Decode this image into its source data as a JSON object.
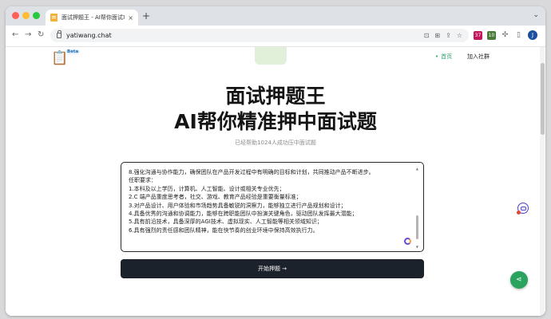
{
  "browser": {
    "tab_title": "面试押题王 - AI帮你面试拿Offer",
    "tab_close": "×",
    "new_tab": "+",
    "url": "yatiwang.chat",
    "profile_initial": "J",
    "ext_badge_a": "37",
    "ext_badge_b": "10"
  },
  "site": {
    "logo_icon": "📋",
    "beta": "Beta",
    "nav": {
      "home": "首页",
      "join": "加入社群"
    }
  },
  "hero": {
    "line1": "面试押题王",
    "line2": "AI帮你精准押中面试题",
    "subtitle": "已经帮助1024人成功压中面试题"
  },
  "job_description": {
    "lines": [
      "8.强化沟通与协作能力，确保团队在产品开发过程中有明确的目标和计划，共同推动产品不断进步。",
      "任职要求：",
      "1.本科及以上学历，计算机、人工智能、设计或相关专业优先；",
      "2.C 端产品重度思考者，社交、游戏、教育产品经验是重要衡量标准；",
      "3.对产品设计、用户体验和市场趋势具备敏锐的洞察力，能够独立进行产品规划和设计；",
      "4.具备优秀的沟通和协调能力，能够在跨职能团队中扮演关键角色，驱动团队发挥最大潜能；",
      "5.具有前沿技术，具备深厚的AGI技术、虚拟现实、人工智能等相关领域知识；",
      "6.具有强烈的责任感和团队精神，能在快节奏的创业环境中保持高效执行力。"
    ]
  },
  "actions": {
    "start_button": "开始押题 →",
    "share_icon": "share-icon"
  },
  "colors": {
    "accent_green": "#27a36b",
    "button_dark": "#1c222b",
    "share_green": "#2aa35e"
  }
}
